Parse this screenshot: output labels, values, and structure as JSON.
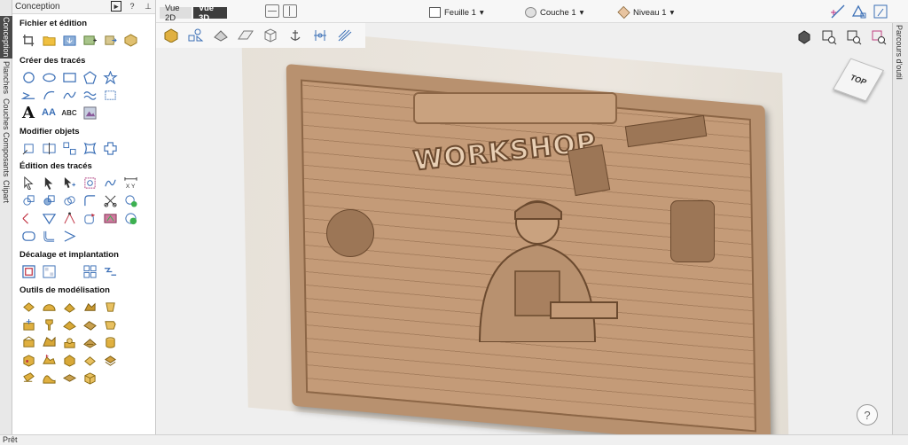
{
  "left_tabs": [
    "Conception",
    "Planches",
    "Couches",
    "Composants",
    "Clipart"
  ],
  "panel": {
    "title": "Conception",
    "help_label": "?",
    "sections": [
      {
        "title": "Fichier et édition"
      },
      {
        "title": "Créer des tracés"
      },
      {
        "title": "Modifier objets"
      },
      {
        "title": "Édition des tracés"
      },
      {
        "title": "Décalage et implantation"
      },
      {
        "title": "Outils de modélisation"
      }
    ]
  },
  "topbar": {
    "view2d": "Vue 2D",
    "view3d": "Vue 3D",
    "sheet": "Feuille 1",
    "layer": "Couche 1",
    "level": "Niveau 1"
  },
  "viewport": {
    "relief_text": "WORKSHOP",
    "viewcube_label": "TOP",
    "help_label": "?"
  },
  "right_tabs": [
    "Parcours d'outil"
  ],
  "status": "Prêt",
  "colors": {
    "accent": "#3b6fb6",
    "relief": "#b8916f",
    "board": "#e6e0d7"
  }
}
